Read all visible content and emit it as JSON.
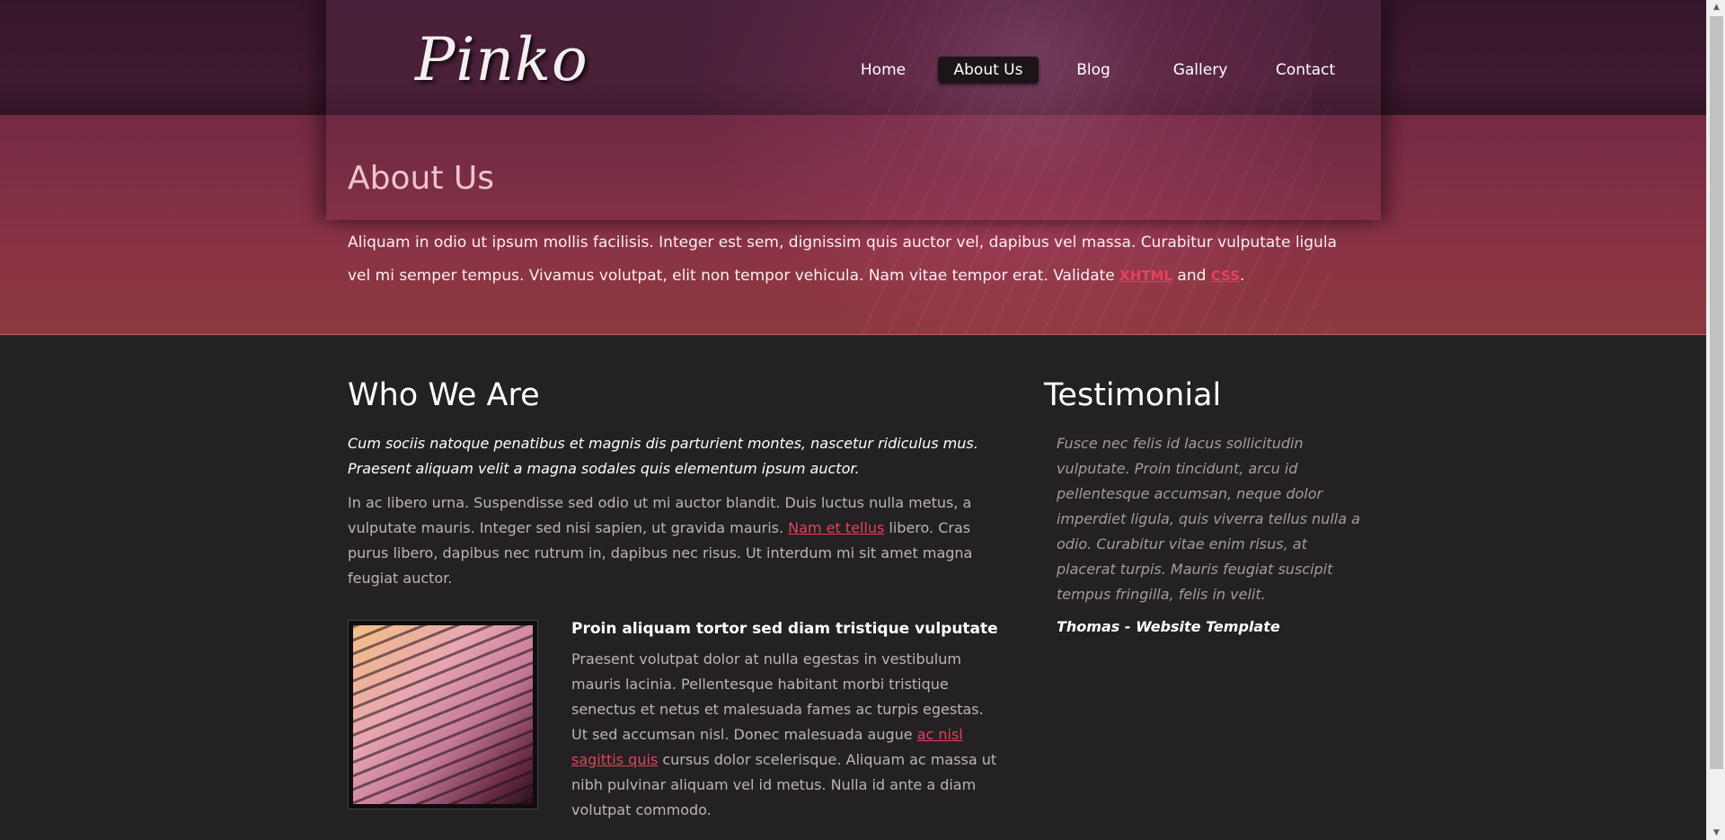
{
  "brand": {
    "logo": "Pinko"
  },
  "nav": {
    "items": [
      {
        "label": "Home"
      },
      {
        "label": "About Us"
      },
      {
        "label": "Blog"
      },
      {
        "label": "Gallery"
      },
      {
        "label": "Contact"
      }
    ],
    "active": "About Us"
  },
  "hero": {
    "title": "About Us",
    "intro_text": "Aliquam in odio ut ipsum mollis facilisis. Integer est sem, dignissim quis auctor vel, dapibus vel massa. Curabitur vulputate ligula vel mi semper tempus. Vivamus volutpat, elit non tempor vehicula. Nam vitae tempor erat. Validate ",
    "link_xhtml": "XHTML",
    "and_text": " and ",
    "link_css": "CSS",
    "period": "."
  },
  "who_we_are": {
    "heading": "Who We Are",
    "lead": "Cum sociis natoque penatibus et magnis dis parturient montes, nascetur ridiculus mus. Praesent aliquam velit a magna sodales quis elementum ipsum auctor.",
    "para_before": "In ac libero urna. Suspendisse sed odio ut mi auctor blandit. Duis luctus nulla metus, a vulputate mauris. Integer sed nisi sapien, ut gravida mauris. ",
    "para_link": "Nam et tellus",
    "para_after": " libero. Cras purus libero, dapibus nec rutrum in, dapibus nec risus. Ut interdum mi sit amet magna feugiat auctor."
  },
  "feature": {
    "title": "Proin aliquam tortor sed diam tristique vulputate",
    "text_before": "Praesent volutpat dolor at nulla egestas in vestibulum mauris lacinia. Pellentesque habitant morbi tristique senectus et netus et malesuada fames ac turpis egestas. Ut sed accumsan nisl. Donec malesuada augue ",
    "text_link": "ac nisl sagittis quis",
    "text_after": " cursus dolor scelerisque. Aliquam ac massa ut nibh pulvinar aliquam vel id metus. Nulla id ante a diam volutpat commodo."
  },
  "testimonial": {
    "heading": "Testimonial",
    "quote": "Fusce nec felis id lacus sollicitudin vulputate. Proin tincidunt, arcu id pellentesque accumsan, neque dolor imperdiet ligula, quis viverra tellus nulla a odio. Curabitur vitae enim risus, at placerat turpis. Mauris feugiat suscipit tempus fringilla, felis in velit.",
    "author": "Thomas - Website Template"
  },
  "icons": {
    "scroll_up": "scroll-up-arrow-icon",
    "scroll_down": "scroll-down-arrow-icon"
  },
  "colors": {
    "accent_link": "#e8405d",
    "body_bg": "#232122",
    "title_pink": "#f0c4cc"
  }
}
